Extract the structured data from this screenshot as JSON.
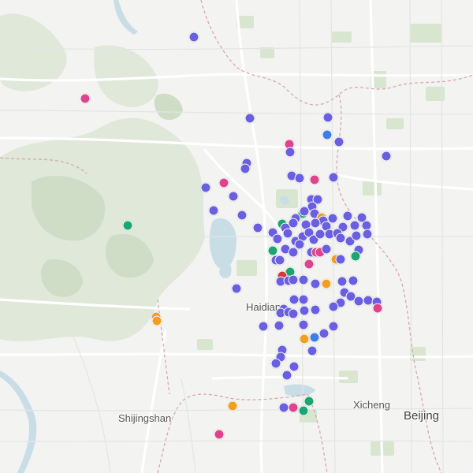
{
  "colors": {
    "purple": "#6a5fe0",
    "pink": "#e0438d",
    "green": "#1aa673",
    "orange": "#f0a020",
    "blue": "#3b7fe6",
    "red": "#d83a3a"
  },
  "labels": {
    "haidian": "Haidian",
    "shijingshan": "Shijingshan",
    "xicheng": "Xicheng",
    "beijing": "Beijing"
  }
}
